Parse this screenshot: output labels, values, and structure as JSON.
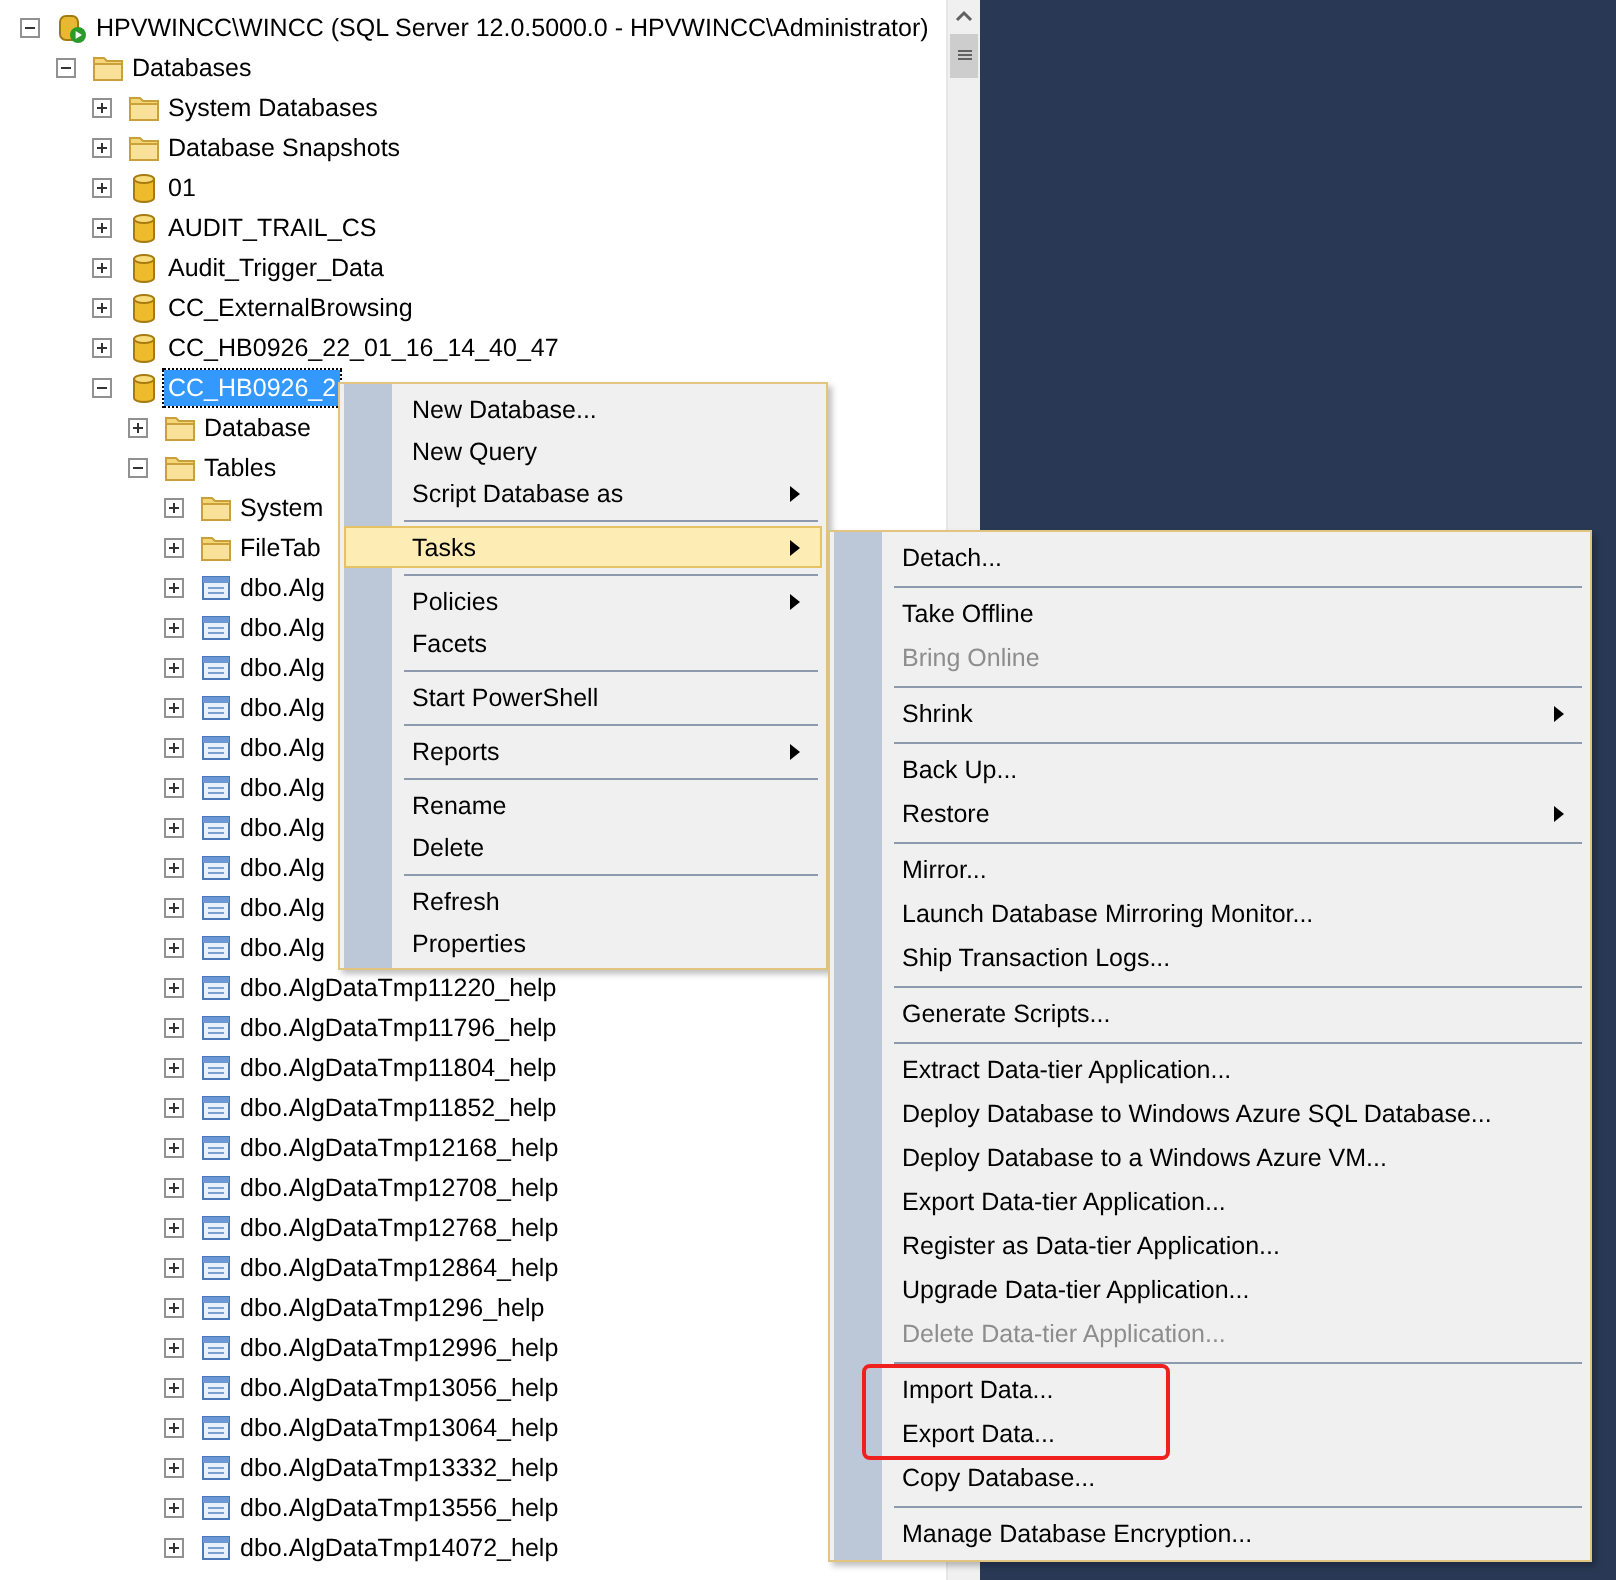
{
  "tree": [
    {
      "label": "HPVWINCC\\WINCC (SQL Server 12.0.5000.0 - HPVWINCC\\Administrator)",
      "kind": "server",
      "expanded": true,
      "selected": false,
      "children": [
        {
          "label": "Databases",
          "kind": "folder",
          "expanded": true,
          "selected": false,
          "children": [
            {
              "label": "System Databases",
              "kind": "folder",
              "expanded": false,
              "selected": false
            },
            {
              "label": "Database Snapshots",
              "kind": "folder",
              "expanded": false,
              "selected": false
            },
            {
              "label": "01",
              "kind": "database",
              "expanded": false,
              "selected": false
            },
            {
              "label": "AUDIT_TRAIL_CS",
              "kind": "database",
              "expanded": false,
              "selected": false
            },
            {
              "label": "Audit_Trigger_Data",
              "kind": "database",
              "expanded": false,
              "selected": false
            },
            {
              "label": "CC_ExternalBrowsing",
              "kind": "database",
              "expanded": false,
              "selected": false
            },
            {
              "label": "CC_HB0926_22_01_16_14_40_47",
              "kind": "database",
              "expanded": false,
              "selected": false
            },
            {
              "label": "CC_HB0926_2",
              "kind": "database",
              "expanded": true,
              "selected": true,
              "children": [
                {
                  "label": "Database",
                  "kind": "folder",
                  "expanded": false,
                  "selected": false
                },
                {
                  "label": "Tables",
                  "kind": "folder",
                  "expanded": true,
                  "selected": false,
                  "children": [
                    {
                      "label": "System",
                      "kind": "folder",
                      "expanded": false,
                      "selected": false
                    },
                    {
                      "label": "FileTab",
                      "kind": "folder",
                      "expanded": false,
                      "selected": false
                    },
                    {
                      "label": "dbo.Alg",
                      "kind": "table",
                      "expanded": false,
                      "selected": false
                    },
                    {
                      "label": "dbo.Alg",
                      "kind": "table",
                      "expanded": false,
                      "selected": false
                    },
                    {
                      "label": "dbo.Alg",
                      "kind": "table",
                      "expanded": false,
                      "selected": false
                    },
                    {
                      "label": "dbo.Alg",
                      "kind": "table",
                      "expanded": false,
                      "selected": false
                    },
                    {
                      "label": "dbo.Alg",
                      "kind": "table",
                      "expanded": false,
                      "selected": false
                    },
                    {
                      "label": "dbo.Alg",
                      "kind": "table",
                      "expanded": false,
                      "selected": false
                    },
                    {
                      "label": "dbo.Alg",
                      "kind": "table",
                      "expanded": false,
                      "selected": false
                    },
                    {
                      "label": "dbo.Alg",
                      "kind": "table",
                      "expanded": false,
                      "selected": false
                    },
                    {
                      "label": "dbo.Alg",
                      "kind": "table",
                      "expanded": false,
                      "selected": false
                    },
                    {
                      "label": "dbo.Alg",
                      "kind": "table",
                      "expanded": false,
                      "selected": false
                    },
                    {
                      "label": "dbo.AlgDataTmp11220_help",
                      "kind": "table",
                      "expanded": false,
                      "selected": false
                    },
                    {
                      "label": "dbo.AlgDataTmp11796_help",
                      "kind": "table",
                      "expanded": false,
                      "selected": false
                    },
                    {
                      "label": "dbo.AlgDataTmp11804_help",
                      "kind": "table",
                      "expanded": false,
                      "selected": false
                    },
                    {
                      "label": "dbo.AlgDataTmp11852_help",
                      "kind": "table",
                      "expanded": false,
                      "selected": false
                    },
                    {
                      "label": "dbo.AlgDataTmp12168_help",
                      "kind": "table",
                      "expanded": false,
                      "selected": false
                    },
                    {
                      "label": "dbo.AlgDataTmp12708_help",
                      "kind": "table",
                      "expanded": false,
                      "selected": false
                    },
                    {
                      "label": "dbo.AlgDataTmp12768_help",
                      "kind": "table",
                      "expanded": false,
                      "selected": false
                    },
                    {
                      "label": "dbo.AlgDataTmp12864_help",
                      "kind": "table",
                      "expanded": false,
                      "selected": false
                    },
                    {
                      "label": "dbo.AlgDataTmp1296_help",
                      "kind": "table",
                      "expanded": false,
                      "selected": false
                    },
                    {
                      "label": "dbo.AlgDataTmp12996_help",
                      "kind": "table",
                      "expanded": false,
                      "selected": false
                    },
                    {
                      "label": "dbo.AlgDataTmp13056_help",
                      "kind": "table",
                      "expanded": false,
                      "selected": false
                    },
                    {
                      "label": "dbo.AlgDataTmp13064_help",
                      "kind": "table",
                      "expanded": false,
                      "selected": false
                    },
                    {
                      "label": "dbo.AlgDataTmp13332_help",
                      "kind": "table",
                      "expanded": false,
                      "selected": false
                    },
                    {
                      "label": "dbo.AlgDataTmp13556_help",
                      "kind": "table",
                      "expanded": false,
                      "selected": false
                    },
                    {
                      "label": "dbo.AlgDataTmp14072_help",
                      "kind": "table",
                      "expanded": false,
                      "selected": false
                    }
                  ]
                }
              ]
            }
          ]
        }
      ]
    }
  ],
  "context_menu": {
    "groups": [
      [
        {
          "label": "New Database...",
          "submenu": false,
          "selected": false,
          "disabled": false
        },
        {
          "label": "New Query",
          "submenu": false,
          "selected": false,
          "disabled": false
        },
        {
          "label": "Script Database as",
          "submenu": true,
          "selected": false,
          "disabled": false
        }
      ],
      [
        {
          "label": "Tasks",
          "submenu": true,
          "selected": true,
          "disabled": false
        }
      ],
      [
        {
          "label": "Policies",
          "submenu": true,
          "selected": false,
          "disabled": false
        },
        {
          "label": "Facets",
          "submenu": false,
          "selected": false,
          "disabled": false
        }
      ],
      [
        {
          "label": "Start PowerShell",
          "submenu": false,
          "selected": false,
          "disabled": false
        }
      ],
      [
        {
          "label": "Reports",
          "submenu": true,
          "selected": false,
          "disabled": false
        }
      ],
      [
        {
          "label": "Rename",
          "submenu": false,
          "selected": false,
          "disabled": false
        },
        {
          "label": "Delete",
          "submenu": false,
          "selected": false,
          "disabled": false
        }
      ],
      [
        {
          "label": "Refresh",
          "submenu": false,
          "selected": false,
          "disabled": false
        },
        {
          "label": "Properties",
          "submenu": false,
          "selected": false,
          "disabled": false
        }
      ]
    ]
  },
  "tasks_menu": {
    "groups": [
      [
        {
          "label": "Detach...",
          "submenu": false,
          "disabled": false,
          "marked": false
        }
      ],
      [
        {
          "label": "Take Offline",
          "submenu": false,
          "disabled": false,
          "marked": false
        },
        {
          "label": "Bring Online",
          "submenu": false,
          "disabled": true,
          "marked": false
        }
      ],
      [
        {
          "label": "Shrink",
          "submenu": true,
          "disabled": false,
          "marked": false
        }
      ],
      [
        {
          "label": "Back Up...",
          "submenu": false,
          "disabled": false,
          "marked": false
        },
        {
          "label": "Restore",
          "submenu": true,
          "disabled": false,
          "marked": false
        }
      ],
      [
        {
          "label": "Mirror...",
          "submenu": false,
          "disabled": false,
          "marked": false
        },
        {
          "label": "Launch Database Mirroring Monitor...",
          "submenu": false,
          "disabled": false,
          "marked": false
        },
        {
          "label": "Ship Transaction Logs...",
          "submenu": false,
          "disabled": false,
          "marked": false
        }
      ],
      [
        {
          "label": "Generate Scripts...",
          "submenu": false,
          "disabled": false,
          "marked": false
        }
      ],
      [
        {
          "label": "Extract Data-tier Application...",
          "submenu": false,
          "disabled": false,
          "marked": false
        },
        {
          "label": "Deploy Database to Windows Azure SQL Database...",
          "submenu": false,
          "disabled": false,
          "marked": false
        },
        {
          "label": "Deploy Database to a Windows Azure VM...",
          "submenu": false,
          "disabled": false,
          "marked": false
        },
        {
          "label": "Export Data-tier Application...",
          "submenu": false,
          "disabled": false,
          "marked": false
        },
        {
          "label": "Register as Data-tier Application...",
          "submenu": false,
          "disabled": false,
          "marked": false
        },
        {
          "label": "Upgrade Data-tier Application...",
          "submenu": false,
          "disabled": false,
          "marked": false
        },
        {
          "label": "Delete Data-tier Application...",
          "submenu": false,
          "disabled": true,
          "marked": false
        }
      ],
      [
        {
          "label": "Import Data...",
          "submenu": false,
          "disabled": false,
          "marked": true
        },
        {
          "label": "Export Data...",
          "submenu": false,
          "disabled": false,
          "marked": true
        },
        {
          "label": "Copy Database...",
          "submenu": false,
          "disabled": false,
          "marked": false
        }
      ],
      [
        {
          "label": "Manage Database Encryption...",
          "submenu": false,
          "disabled": false,
          "marked": false
        }
      ]
    ]
  }
}
